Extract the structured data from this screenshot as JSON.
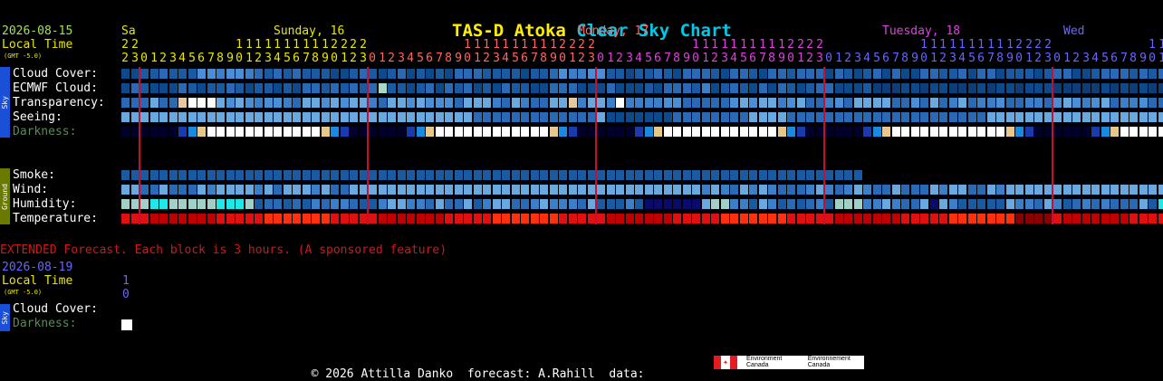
{
  "title": {
    "part1": "TAS-D Atoka ",
    "part2": "Clear Sky Chart"
  },
  "header": {
    "date": "2026-08-15",
    "local_time": "Local Time",
    "gmt": "(GMT -5.0)",
    "day_labels": [
      {
        "text": "Sa",
        "col": 0,
        "color": "#e8e800"
      },
      {
        "text": "Sunday, 16",
        "col": 16,
        "color": "#e8e800"
      },
      {
        "text": "Monday, 17",
        "col": 48,
        "color": "#ff6666"
      },
      {
        "text": "Tuesday, 18",
        "col": 80,
        "color": "#e040e0"
      },
      {
        "text": "Wed",
        "col": 99,
        "color": "#6666ff"
      }
    ]
  },
  "rows_sky": {
    "cloud": "Cloud Cover:",
    "ecmwf": "ECMWF Cloud:",
    "transparency": "Transparency:",
    "seeing": "Seeing:",
    "darkness": "Darkness:"
  },
  "rows_ground": {
    "smoke": "Smoke:",
    "wind": "Wind:",
    "humidity": "Humidity:",
    "temperature": "Temperature:"
  },
  "sidebar": {
    "sky": "Sky",
    "ground": "Ground"
  },
  "extended": {
    "note": "EXTENDED Forecast. Each block is 3 hours. (A sponsored feature)",
    "date": "2026-08-19",
    "local_time": "Local Time",
    "gmt": "(GMT -5.0)",
    "hour_tens": "1",
    "hour_ones": "0",
    "cloud": "Cloud Cover:",
    "darkness": "Darkness:"
  },
  "footer": {
    "text": "© 2026 Attilla Danko  forecast: A.Rahill  data:",
    "ec_en": "Environment Canada",
    "ec_fr": "Environnement Canada"
  },
  "hours_start": 22,
  "num_cols": 110,
  "colors": {
    "cloud_clear": "#0d4a8c",
    "cloud_mid": "#3a7fc8",
    "cloud_light": "#6aa8e0",
    "transparency_white": "#ffffff",
    "temp_red": "#e01010",
    "darkness_black": "#00001a",
    "midnight_line": "#c8102e"
  }
}
